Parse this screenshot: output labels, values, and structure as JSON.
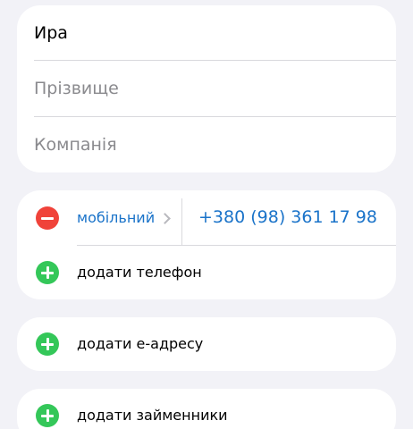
{
  "name_card": {
    "first_name": "Ира",
    "last_name_placeholder": "Прізвище",
    "company_placeholder": "Компанія"
  },
  "phone_card": {
    "phone_label": "мобільний",
    "phone_number": "+380 (98) 361 17 98",
    "add_phone_label": "додати телефон"
  },
  "email_card": {
    "add_email_label": "додати е-адресу"
  },
  "pronoun_card": {
    "add_pronouns_label": "додати займенники"
  },
  "colors": {
    "remove": "#f0433a",
    "add": "#34c759",
    "accent": "#1a73c9"
  }
}
